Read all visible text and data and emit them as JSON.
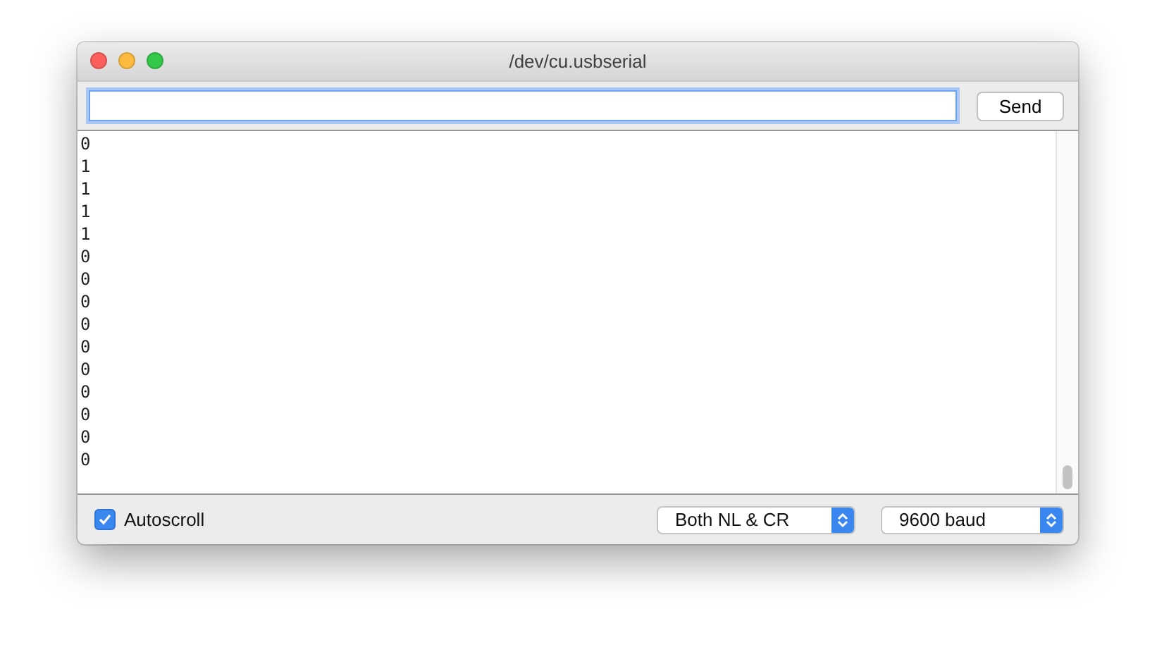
{
  "window": {
    "title": "/dev/cu.usbserial"
  },
  "send_button": "Send",
  "output_lines": [
    "0",
    "1",
    "1",
    "1",
    "1",
    "0",
    "0",
    "0",
    "0",
    "0",
    "0",
    "0",
    "0",
    "0",
    "0"
  ],
  "autoscroll": {
    "label": "Autoscroll",
    "checked": true
  },
  "line_ending": {
    "value": "Both NL & CR"
  },
  "baud": {
    "value": "9600 baud"
  }
}
